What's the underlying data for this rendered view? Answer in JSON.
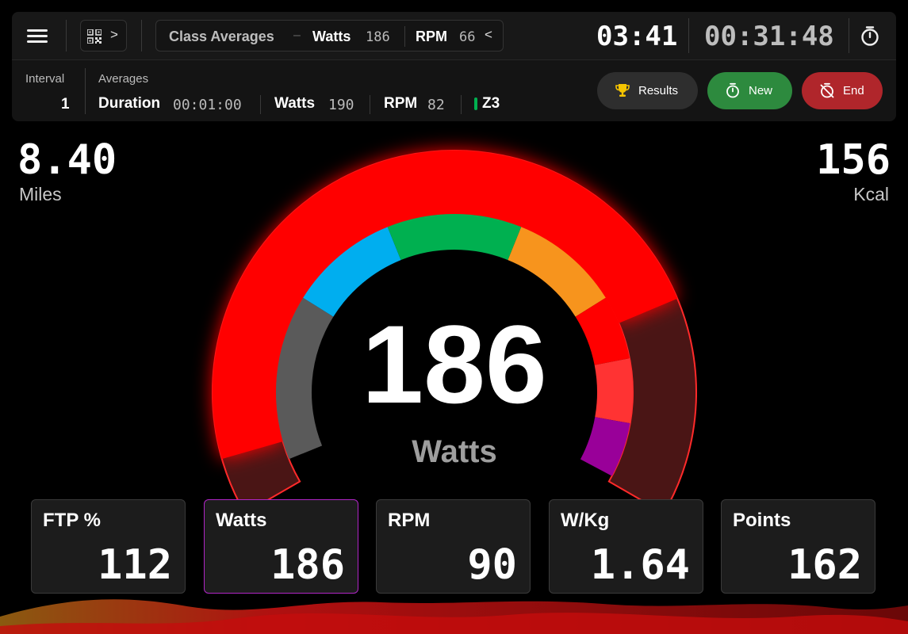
{
  "topbar": {
    "class_title": "Class Averages",
    "class_separator": "–",
    "class_watts_label": "Watts",
    "class_watts_value": "186",
    "class_rpm_label": "RPM",
    "class_rpm_value": "66",
    "clock": "03:41",
    "elapsed": "00:31:48",
    "qr_chevron": ">",
    "class_chevron": "<"
  },
  "interval_bar": {
    "interval_label": "Interval",
    "interval_value": "1",
    "averages_label": "Averages",
    "duration_label": "Duration",
    "duration_value": "00:01:00",
    "watts_label": "Watts",
    "watts_value": "190",
    "rpm_label": "RPM",
    "rpm_value": "82",
    "zone_label": "Z3",
    "zone_color": "#00b050"
  },
  "buttons": {
    "results": "Results",
    "new": "New",
    "end": "End",
    "results_color": "#2e2e2e",
    "new_color": "#2d8a3e",
    "end_color": "#b0262b"
  },
  "stats": {
    "miles_value": "8.40",
    "miles_label": "Miles",
    "kcal_value": "156",
    "kcal_label": "Kcal"
  },
  "gauge": {
    "value": "186",
    "label": "Watts",
    "progress_fraction": 0.78,
    "zone_colors": [
      "#5a5a5a",
      "#00aeef",
      "#00b050",
      "#f7941d",
      "#ff0000",
      "#ff3333",
      "#990099"
    ],
    "glow_color": "#ff0000"
  },
  "cards": [
    {
      "title": "FTP %",
      "value": "112",
      "active": false
    },
    {
      "title": "Watts",
      "value": "186",
      "active": true
    },
    {
      "title": "RPM",
      "value": "90",
      "active": false
    },
    {
      "title": "W/Kg",
      "value": "1.64",
      "active": false
    },
    {
      "title": "Points",
      "value": "162",
      "active": false
    }
  ],
  "icons": {
    "menu": "hamburger-menu-icon",
    "qr": "qr-code-icon",
    "stopwatch": "stopwatch-icon",
    "results": "trophy-icon",
    "new": "timer-icon",
    "end": "timer-off-icon"
  }
}
